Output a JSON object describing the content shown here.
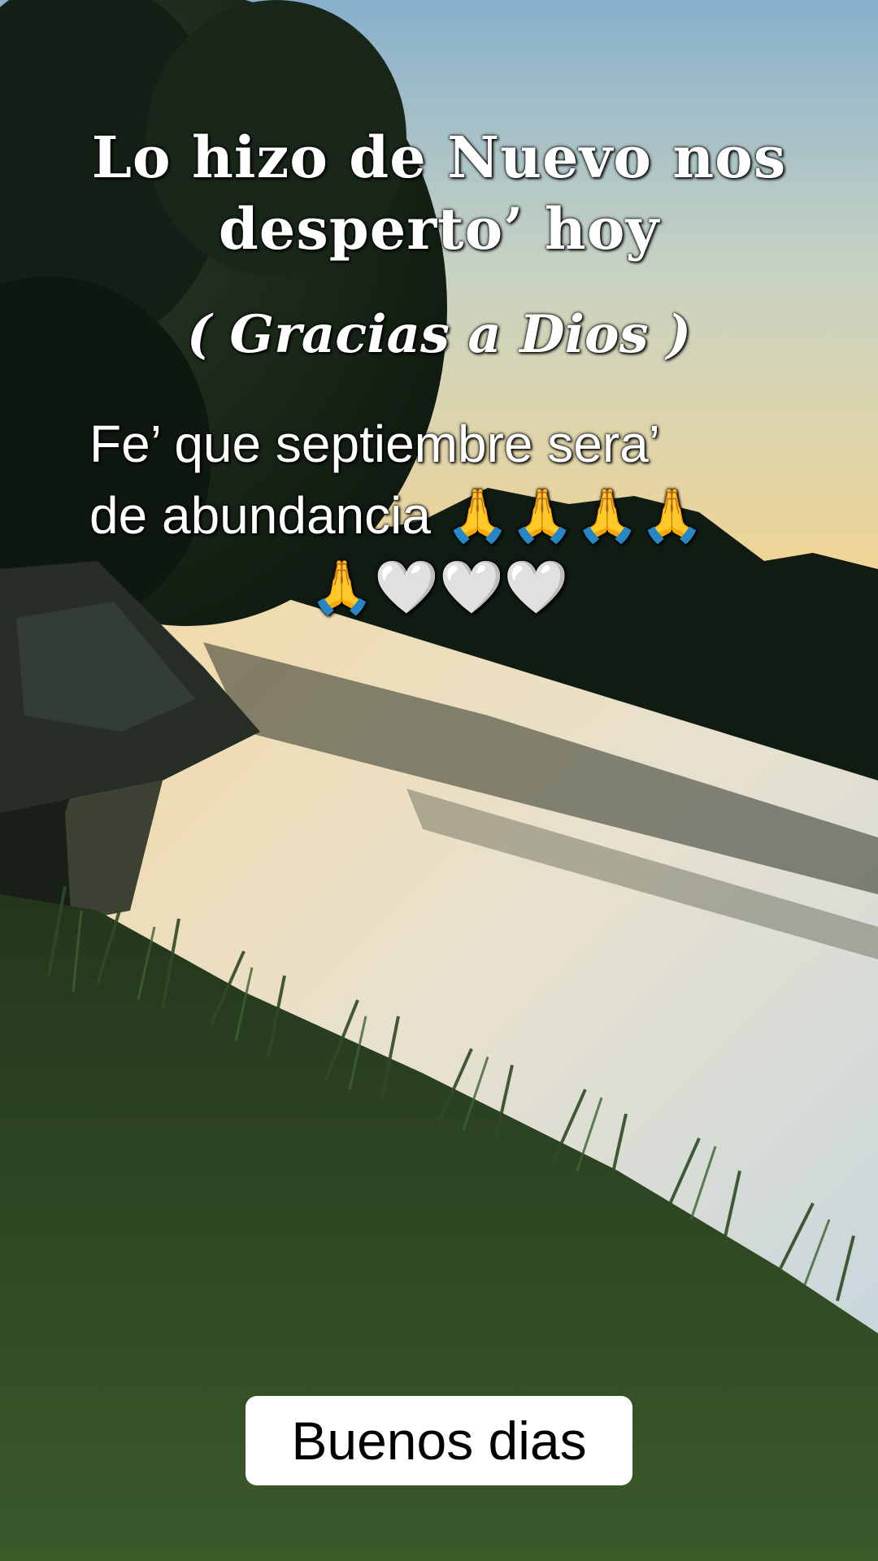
{
  "caption": {
    "title_line1": "Lo hizo de Nuevo nos",
    "title_line2": "desperto’ hoy",
    "subtitle": "( Gracias a Dios )",
    "message_line1": "Fe’ que septiembre sera’",
    "message_line2": "de abundancia 🙏🙏🙏🙏",
    "message_line3": "🙏🤍🤍🤍"
  },
  "greeting": {
    "text": "Buenos dias"
  },
  "colors": {
    "sky_top": "#8fb5cf",
    "sky_horizon": "#f4d79a",
    "water": "#e9dcc0",
    "foliage": "#1e2a1c",
    "grass": "#2e4a22",
    "text": "#ffffff",
    "greeting_bg": "#ffffff",
    "greeting_text": "#000000"
  }
}
